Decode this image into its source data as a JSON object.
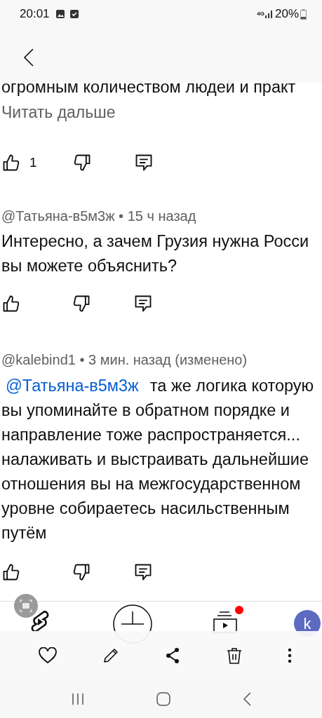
{
  "status_bar": {
    "time": "20:01",
    "network": "4G",
    "battery": "20%"
  },
  "top_comment": {
    "lines": [
      "огромным количеством людей и практ"
    ],
    "read_more": "Читать дальше",
    "likes": "1"
  },
  "comments": [
    {
      "header": "@Татьяна-в5м3ж • 15 ч назад",
      "lines": [
        "Интересно, а зачем Грузия нужна Росси",
        "вы можете объяснить?"
      ]
    },
    {
      "header": "@kalebind1 • 3 мин. назад (изменено)",
      "mention": "@Татьяна-в5м3ж",
      "lines": [
        "та же логика которую",
        "вы упоминайте в обратном порядке и",
        "направление тоже распространяется...",
        "налаживать и выстраивать дальнейшие",
        "отношения вы на межгосударственном",
        "уровне собираетесь насильственным",
        "путём"
      ]
    }
  ],
  "youtube_nav": [
    {
      "kind": "shorts"
    },
    {
      "kind": "create"
    },
    {
      "kind": "subscriptions",
      "badge": true
    },
    {
      "kind": "you",
      "avatar": "k"
    }
  ]
}
